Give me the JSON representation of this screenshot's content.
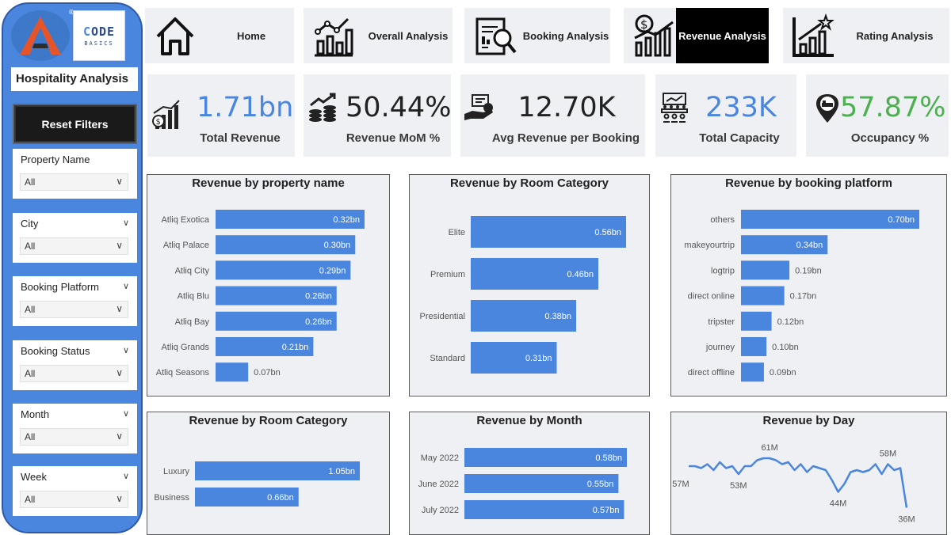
{
  "sidebar": {
    "brand_reg": "®",
    "code_basics_line1": "ODE",
    "code_basics_line2": "BASICS",
    "app_title": "Hospitality Analysis",
    "reset_label": "Reset Filters",
    "slicers": [
      {
        "label": "Property Name",
        "value": "All"
      },
      {
        "label": "City",
        "value": "All"
      },
      {
        "label": "Booking Platform",
        "value": "All"
      },
      {
        "label": "Booking Status",
        "value": "All"
      },
      {
        "label": "Month",
        "value": "All"
      },
      {
        "label": "Week",
        "value": "All"
      }
    ]
  },
  "nav": [
    {
      "label": "Home",
      "icon": "home-icon",
      "active": false
    },
    {
      "label": "Overall Analysis",
      "icon": "bar-chart-icon",
      "active": false
    },
    {
      "label": "Booking Analysis",
      "icon": "report-search-icon",
      "active": false
    },
    {
      "label": "Revenue Analysis",
      "icon": "dollar-chart-icon",
      "active": true
    },
    {
      "label": "Rating Analysis",
      "icon": "star-chart-icon",
      "active": false
    }
  ],
  "kpis": [
    {
      "value": "1.71bn",
      "label": "Total Revenue",
      "color": "#4a86dd",
      "icon": "money-chart-icon"
    },
    {
      "value": "50.44%",
      "label": "Revenue MoM %",
      "color": "#222222",
      "icon": "coins-growth-icon"
    },
    {
      "value": "12.70K",
      "label": "Avg Revenue per Booking",
      "color": "#222222",
      "icon": "hand-money-icon"
    },
    {
      "value": "233K",
      "label": "Total Capacity",
      "color": "#4a86dd",
      "icon": "conference-icon"
    },
    {
      "value": "57.87%",
      "label": "Occupancy %",
      "color": "#4caf50",
      "icon": "location-bed-icon"
    }
  ],
  "colors": {
    "bar": "#4a86dd",
    "line": "#4a86dd",
    "active_nav": "#000000"
  },
  "chart_data": [
    {
      "type": "bar",
      "title": "Revenue by property name",
      "categories": [
        "Atliq Exotica",
        "Atliq Palace",
        "Atliq City",
        "Atliq Blu",
        "Atliq Bay",
        "Atliq Grands",
        "Atliq Seasons"
      ],
      "values": [
        0.32,
        0.3,
        0.29,
        0.26,
        0.26,
        0.21,
        0.07
      ],
      "labels": [
        "0.32bn",
        "0.30bn",
        "0.29bn",
        "0.26bn",
        "0.26bn",
        "0.21bn",
        "0.07bn"
      ],
      "orientation": "horizontal"
    },
    {
      "type": "bar",
      "title": "Revenue by Room Category",
      "categories": [
        "Elite",
        "Premium",
        "Presidential",
        "Standard"
      ],
      "values": [
        0.56,
        0.46,
        0.38,
        0.31
      ],
      "labels": [
        "0.56bn",
        "0.46bn",
        "0.38bn",
        "0.31bn"
      ],
      "orientation": "horizontal"
    },
    {
      "type": "bar",
      "title": "Revenue by booking platform",
      "categories": [
        "others",
        "makeyourtrip",
        "logtrip",
        "direct online",
        "tripster",
        "journey",
        "direct offline"
      ],
      "values": [
        0.7,
        0.34,
        0.19,
        0.17,
        0.12,
        0.1,
        0.09
      ],
      "labels": [
        "0.70bn",
        "0.34bn",
        "0.19bn",
        "0.17bn",
        "0.12bn",
        "0.10bn",
        "0.09bn"
      ],
      "orientation": "horizontal"
    },
    {
      "type": "bar",
      "title": "Revenue by Room Category",
      "categories": [
        "Luxury",
        "Business"
      ],
      "values": [
        1.05,
        0.66
      ],
      "labels": [
        "1.05bn",
        "0.66bn"
      ],
      "orientation": "horizontal"
    },
    {
      "type": "bar",
      "title": "Revenue by Month",
      "categories": [
        "May 2022",
        "June 2022",
        "July 2022"
      ],
      "values": [
        0.58,
        0.55,
        0.57
      ],
      "labels": [
        "0.58bn",
        "0.55bn",
        "0.57bn"
      ],
      "orientation": "horizontal"
    },
    {
      "type": "line",
      "title": "Revenue by Day",
      "values": [
        57,
        57,
        56,
        58,
        55,
        59,
        56,
        57,
        53,
        57,
        57,
        60,
        61,
        61,
        60,
        58,
        59,
        55,
        58,
        54,
        57,
        56,
        55,
        50,
        44,
        48,
        54,
        55,
        54,
        55,
        58,
        53,
        58,
        55,
        56,
        36
      ],
      "annotations": [
        {
          "index": 0,
          "label": "57M"
        },
        {
          "index": 8,
          "label": "53M"
        },
        {
          "index": 13,
          "label": "61M"
        },
        {
          "index": 24,
          "label": "44M"
        },
        {
          "index": 32,
          "label": "58M"
        },
        {
          "index": 35,
          "label": "36M"
        }
      ]
    }
  ]
}
